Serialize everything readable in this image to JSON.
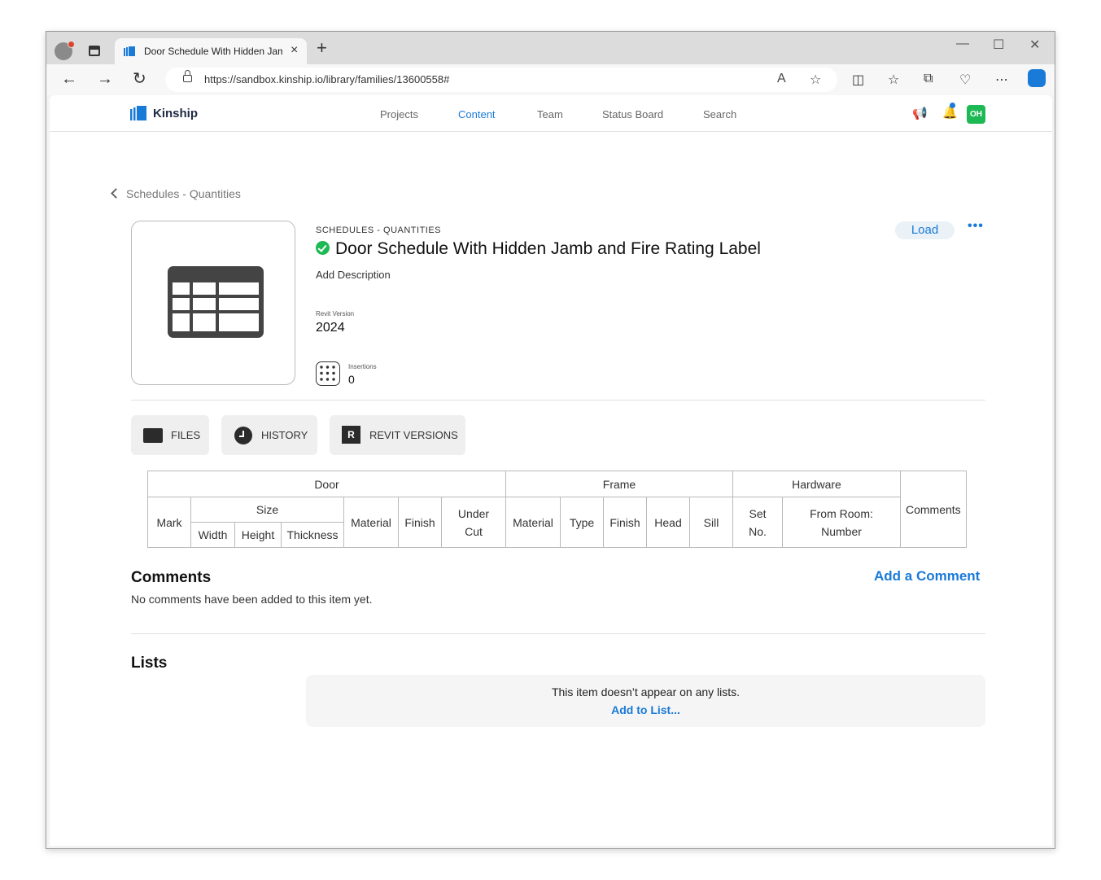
{
  "browser": {
    "tab_title": "Door Schedule With Hidden Jam",
    "new_tab_label": "+",
    "url": "https://sandbox.kinship.io/library/families/13600558#"
  },
  "nav": {
    "brand": "Kinship",
    "links": [
      "Projects",
      "Content",
      "Team",
      "Status Board",
      "Search"
    ],
    "active": "Content",
    "avatar_initials": "OH"
  },
  "breadcrumb": {
    "back_label": "Schedules - Quantities"
  },
  "item": {
    "category": "SCHEDULES - QUANTITIES",
    "title": "Door Schedule With Hidden Jamb and Fire Rating Label",
    "description_placeholder": "Add Description",
    "revit_version_label": "Revit Version",
    "revit_version": "2024",
    "insertions_label": "Insertions",
    "insertions": "0",
    "load_label": "Load",
    "more_label": "•••"
  },
  "tabs": {
    "files": "FILES",
    "history": "HISTORY",
    "revit_versions": "REVIT VERSIONS"
  },
  "schedule": {
    "groups": {
      "door": "Door",
      "frame": "Frame",
      "hardware": "Hardware",
      "comments": "Comments"
    },
    "door": {
      "mark": "Mark",
      "size": "Size",
      "width": "Width",
      "height": "Height",
      "thickness": "Thickness",
      "material": "Material",
      "finish": "Finish",
      "under_cut_1": "Under",
      "under_cut_2": "Cut"
    },
    "frame": {
      "material": "Material",
      "type": "Type",
      "finish": "Finish",
      "head": "Head",
      "sill": "Sill"
    },
    "hardware": {
      "set_1": "Set",
      "set_2": "No.",
      "room_1": "From Room:",
      "room_2": "Number"
    }
  },
  "comments": {
    "title": "Comments",
    "add_label": "Add a Comment",
    "empty_text": "No comments have been added to this item yet."
  },
  "lists": {
    "title": "Lists",
    "empty_text": "This item doesn’t appear on any lists.",
    "add_label": "Add to List..."
  },
  "colors": {
    "accent": "#1a7ad8",
    "verified": "#1db954",
    "avatar": "#1db954"
  }
}
